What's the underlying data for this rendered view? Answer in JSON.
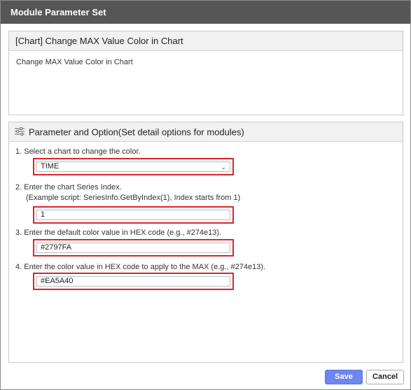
{
  "dialog": {
    "title": "Module Parameter Set"
  },
  "module": {
    "header": "[Chart] Change MAX Value Color in Chart",
    "description": "Change MAX Value Color in Chart"
  },
  "params": {
    "header": "Parameter and Option(Set detail options for modules)",
    "icon": "sliders-icon",
    "step1": {
      "label": "1. Select a chart to change the color.",
      "selected": "TIME"
    },
    "step2": {
      "label": "2. Enter the chart Series Index.",
      "hint": "(Example script: SeriesInfo.GetByIndex(1), Index starts from 1)",
      "value": "1"
    },
    "step3": {
      "label": "3. Enter the default color value in HEX code (e.g., #274e13).",
      "value": "#2797FA"
    },
    "step4": {
      "label": "4. Enter the color value in HEX code to apply to the MAX (e.g., #274e13).",
      "value": "#EA5A40"
    }
  },
  "buttons": {
    "save": "Save",
    "cancel": "Cancel"
  },
  "colors": {
    "titlebar": "#565656",
    "accent": "#6f86f0",
    "highlight": "#d9262c"
  }
}
